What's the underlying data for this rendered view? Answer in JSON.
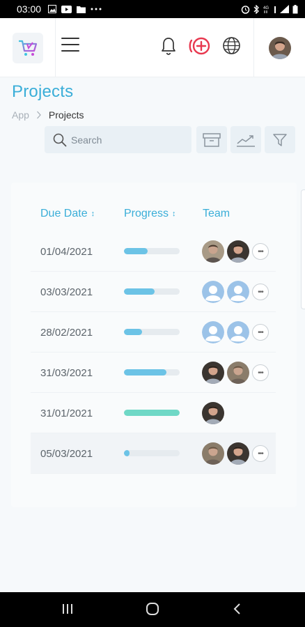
{
  "status_bar": {
    "time": "03:00",
    "left_icons": [
      "image-icon",
      "youtube-icon",
      "folder-icon",
      "more-dots-icon"
    ],
    "right_icons": [
      "alarm-icon",
      "bluetooth-icon",
      "4g-signal-icon",
      "wifi-icon",
      "signal-icon",
      "battery-icon"
    ]
  },
  "header": {
    "logo_icon": "shopping-cart-icon",
    "menu_icon": "hamburger-icon",
    "notification_icon": "bell-icon",
    "add_icon": "add-circle-icon",
    "language_icon": "globe-icon",
    "accent_add_color": "#e8384f"
  },
  "page": {
    "title": "Projects",
    "breadcrumb": {
      "root": "App",
      "separator": ">",
      "current": "Projects"
    }
  },
  "toolbar": {
    "search_placeholder": "Search",
    "search_value": "",
    "archive_icon": "archive-box-icon",
    "chart_icon": "trend-chart-icon",
    "filter_icon": "filter-icon"
  },
  "table": {
    "columns": [
      {
        "label": "Due Date",
        "sortable": true
      },
      {
        "label": "Progress",
        "sortable": true
      },
      {
        "label": "Team",
        "sortable": false
      }
    ],
    "rows": [
      {
        "due_date": "01/04/2021",
        "progress": 0.42,
        "progress_color": "#6cc3e6",
        "team": [
          "photo-avatar-a",
          "photo-avatar-b"
        ],
        "more": true
      },
      {
        "due_date": "03/03/2021",
        "progress": 0.55,
        "progress_color": "#6cc3e6",
        "team": [
          "placeholder-avatar",
          "placeholder-avatar"
        ],
        "more": true
      },
      {
        "due_date": "28/02/2021",
        "progress": 0.33,
        "progress_color": "#6cc3e6",
        "team": [
          "placeholder-avatar",
          "placeholder-avatar"
        ],
        "more": true
      },
      {
        "due_date": "31/03/2021",
        "progress": 0.76,
        "progress_color": "#6cc3e6",
        "team": [
          "photo-avatar-b",
          "photo-avatar-c"
        ],
        "more": true
      },
      {
        "due_date": "31/01/2021",
        "progress": 1.0,
        "progress_color": "#6fd8c6",
        "team": [
          "photo-avatar-b"
        ],
        "more": false
      },
      {
        "due_date": "05/03/2021",
        "progress": 0.1,
        "progress_color": "#6cc3e6",
        "team": [
          "photo-avatar-c",
          "photo-avatar-b"
        ],
        "more": true,
        "highlighted": true
      }
    ]
  },
  "colors": {
    "accent": "#3aaed8",
    "progress_track": "#e6ebef"
  },
  "nav_bar": {
    "buttons": [
      "recents-icon",
      "home-icon",
      "back-icon"
    ]
  }
}
